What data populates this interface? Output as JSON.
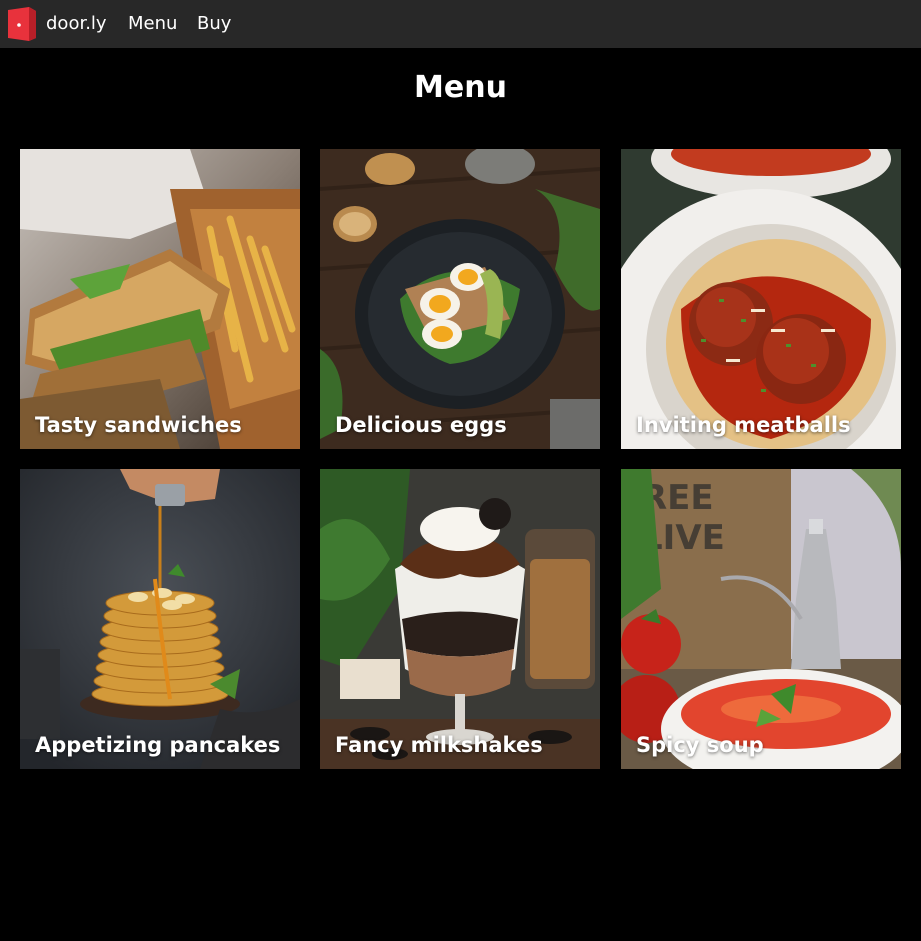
{
  "nav": {
    "brand": "door.ly",
    "logo_icon": "door-logo-icon",
    "links": [
      "Menu",
      "Buy"
    ]
  },
  "main": {
    "title": "Menu",
    "cards": [
      {
        "label": "Tasty sandwiches",
        "image": "sandwich-and-fries-photo"
      },
      {
        "label": "Delicious eggs",
        "image": "boiled-eggs-on-plate-photo"
      },
      {
        "label": "Inviting meatballs",
        "image": "spaghetti-meatballs-photo"
      },
      {
        "label": "Appetizing pancakes",
        "image": "pancake-stack-photo"
      },
      {
        "label": "Fancy milkshakes",
        "image": "chocolate-milkshake-photo"
      },
      {
        "label": "Spicy soup",
        "image": "tomato-soup-photo"
      }
    ]
  },
  "colors": {
    "background": "#000000",
    "navbar": "#282828",
    "brand_accent": "#e8323c",
    "text": "#ffffff"
  }
}
